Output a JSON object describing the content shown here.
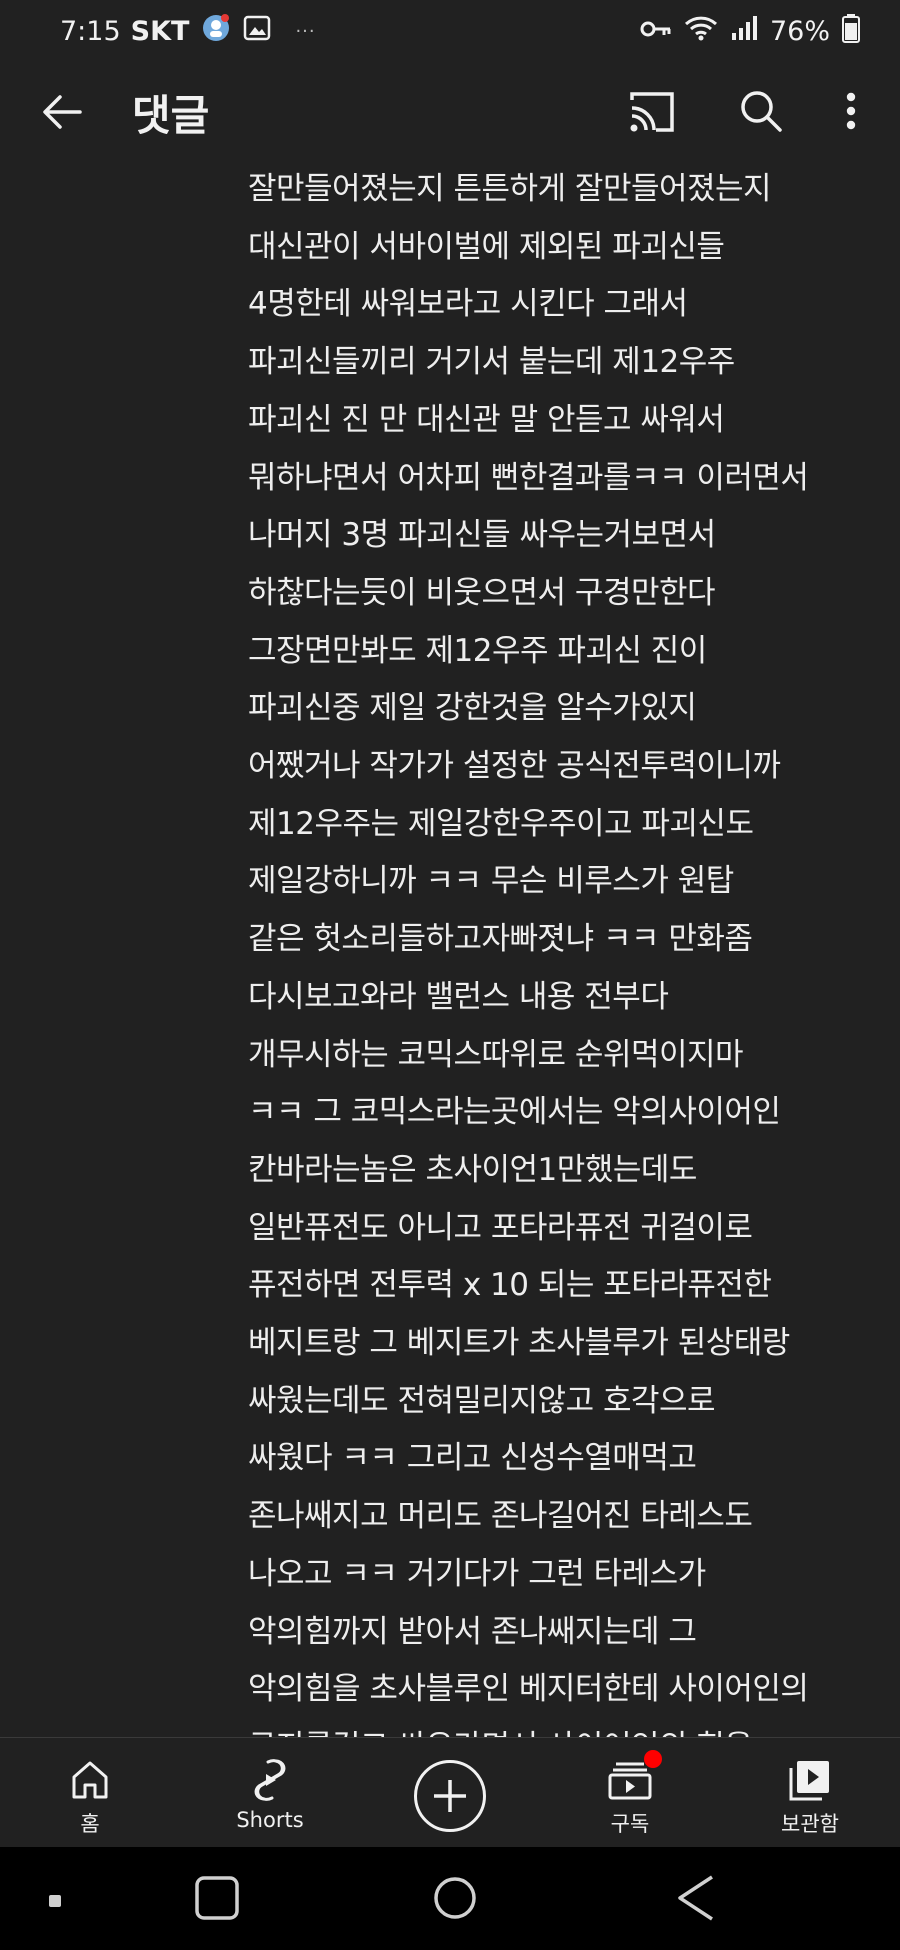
{
  "status_bar": {
    "time": "7:15",
    "carrier": "SKT",
    "dots": "···",
    "battery": "76%"
  },
  "app_bar": {
    "title": "댓글"
  },
  "comment": {
    "lines": [
      "잘만들어졌는지  튼튼하게 잘만들어졌는지",
      "대신관이  서바이벌에 제외된 파괴신들",
      "4명한테  싸워보라고 시킨다  그래서",
      "파괴신들끼리 거기서 붙는데   제12우주",
      "파괴신 진 만  대신관 말 안듣고  싸워서",
      "뭐하냐면서  어차피 뻔한결과를ㅋㅋ 이러면서",
      "나머지 3명 파괴신들 싸우는거보면서",
      "하찮다는듯이 비웃으면서 구경만한다",
      "그장면만봐도 제12우주 파괴신 진이",
      "파괴신중 제일 강한것을 알수가있지",
      "어쨌거나 작가가 설정한 공식전투력이니까",
      "제12우주는 제일강한우주이고  파괴신도",
      "제일강하니까 ㅋㅋ  무슨 비루스가 원탑",
      "같은 헛소리들하고자빠졋냐 ㅋㅋ 만화좀",
      "다시보고와라   밸런스 내용 전부다",
      "개무시하는 코믹스따위로 순위먹이지마",
      "ㅋㅋ  그 코믹스라는곳에서는  악의사이어인",
      "칸바라는놈은  초사이언1만했는데도",
      "일반퓨전도 아니고  포타라퓨전 귀걸이로",
      "퓨전하면 전투력 x 10 되는 포타라퓨전한",
      "베지트랑  그 베지트가 초사블루가 된상태랑",
      "싸웠는데도 전혀밀리지않고 호각으로",
      "싸웠다 ㅋㅋ  그리고 신성수열매먹고",
      "존나쌔지고 머리도 존나길어진 타레스도",
      "나오고 ㅋㅋ 거기다가 그런 타레스가",
      "악의힘까지 받아서 존나쌔지는데  그",
      "악의힘을 초사블루인 베지터한테  사이어인의",
      "긍지를걸고 싸우라면서  사이어인의 힘을"
    ]
  },
  "bottom_nav": {
    "home": "홈",
    "shorts": "Shorts",
    "subscriptions": "구독",
    "library": "보관함"
  },
  "colors": {
    "background": "#212121",
    "text": "#f1f1f1",
    "badge": "#ff0000",
    "system_nav": "#000000"
  }
}
